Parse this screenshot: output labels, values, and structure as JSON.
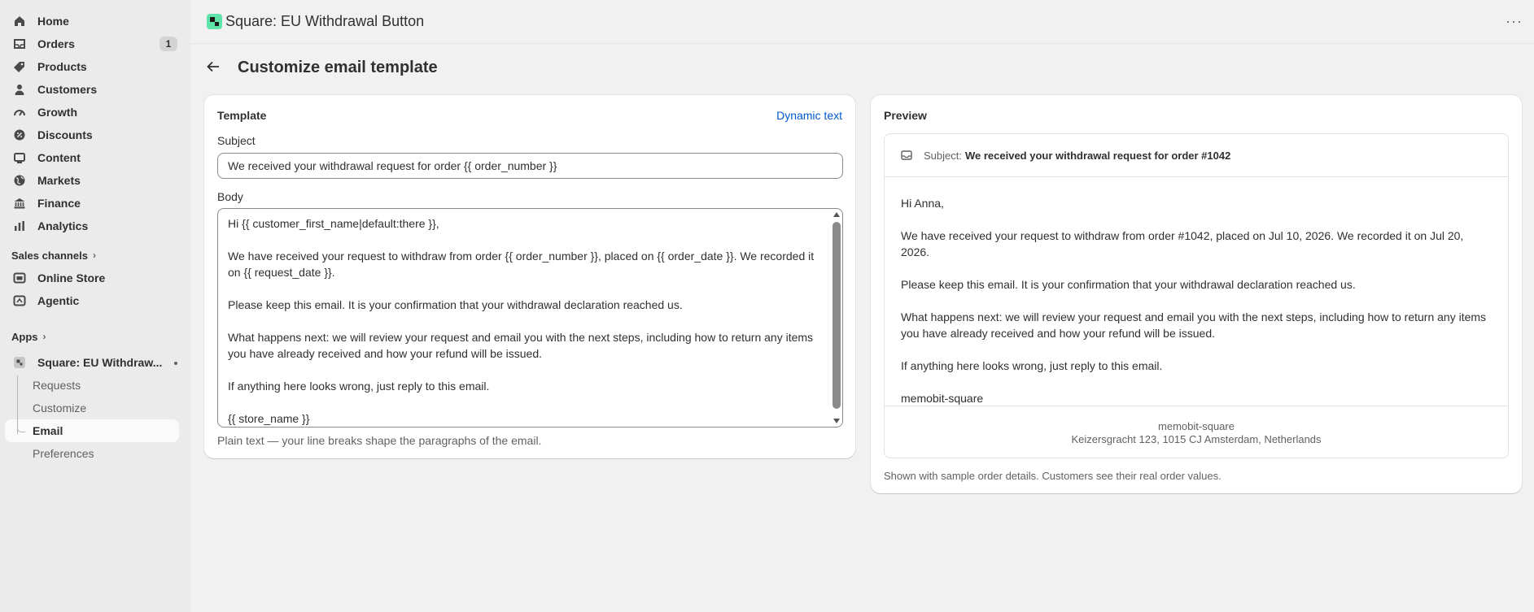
{
  "sidebar": {
    "items": [
      {
        "label": "Home",
        "icon": "home-icon"
      },
      {
        "label": "Orders",
        "icon": "inbox-icon",
        "badge": "1"
      },
      {
        "label": "Products",
        "icon": "tag-icon"
      },
      {
        "label": "Customers",
        "icon": "person-icon"
      },
      {
        "label": "Growth",
        "icon": "gauge-icon"
      },
      {
        "label": "Discounts",
        "icon": "discount-icon"
      },
      {
        "label": "Content",
        "icon": "content-icon"
      },
      {
        "label": "Markets",
        "icon": "globe-icon"
      },
      {
        "label": "Finance",
        "icon": "bank-icon"
      },
      {
        "label": "Analytics",
        "icon": "bar-chart-icon"
      }
    ],
    "sales_channels": {
      "heading": "Sales channels",
      "items": [
        {
          "label": "Online Store",
          "icon": "store-icon"
        },
        {
          "label": "Agentic",
          "icon": "agentic-icon"
        }
      ]
    },
    "apps": {
      "heading": "Apps",
      "app_name": "Square: EU Withdraw...",
      "sub_items": [
        "Requests",
        "Customize",
        "Email",
        "Preferences"
      ],
      "active": "Email"
    }
  },
  "header": {
    "app_title": "Square: EU Withdrawal Button",
    "more_label": "···"
  },
  "page": {
    "title": "Customize email template"
  },
  "template": {
    "title": "Template",
    "dynamic_text_link": "Dynamic text",
    "subject_label": "Subject",
    "subject_value": "We received your withdrawal request for order {{ order_number }}",
    "body_label": "Body",
    "body_value": "Hi {{ customer_first_name|default:there }},\n\nWe have received your request to withdraw from order {{ order_number }}, placed on {{ order_date }}. We recorded it on {{ request_date }}.\n\nPlease keep this email. It is your confirmation that your withdrawal declaration reached us.\n\nWhat happens next: we will review your request and email you with the next steps, including how to return any items you have already received and how your refund will be issued.\n\nIf anything here looks wrong, just reply to this email.\n\n{{ store_name }}",
    "help_text": "Plain text — your line breaks shape the paragraphs of the email."
  },
  "preview": {
    "title": "Preview",
    "subject_prefix": "Subject:",
    "subject": "We received your withdrawal request for order #1042",
    "paragraphs": [
      "Hi Anna,",
      "We have received your request to withdraw from order #1042, placed on Jul 10, 2026. We recorded it on Jul 20, 2026.",
      "Please keep this email. It is your confirmation that your withdrawal declaration reached us.",
      "What happens next: we will review your request and email you with the next steps, including how to return any items you have already received and how your refund will be issued.",
      "If anything here looks wrong, just reply to this email.",
      "memobit-square"
    ],
    "footer_store": "memobit-square",
    "footer_address": "Keizersgracht 123, 1015 CJ Amsterdam, Netherlands",
    "note": "Shown with sample order details. Customers see their real order values."
  },
  "colors": {
    "accent_link": "#005bd3",
    "app_logo": "#5ee3a8",
    "sidebar_bg": "#ebebeb",
    "page_bg": "#f1f1f1"
  }
}
